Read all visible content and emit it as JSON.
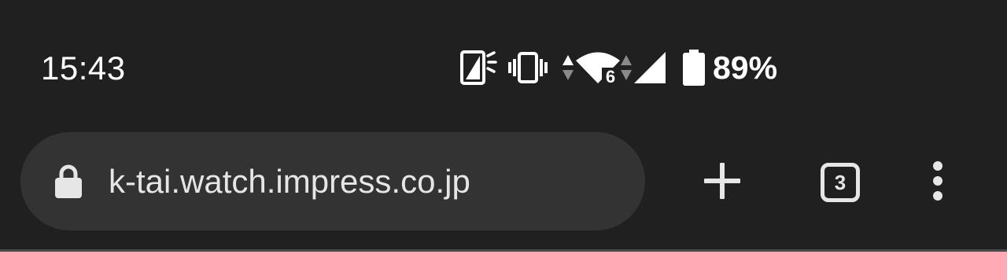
{
  "status_bar": {
    "time": "15:43",
    "wifi_badge": "6",
    "battery_percent": "89%",
    "battery_level": 0.89,
    "icons": [
      "auto-rotate-icon",
      "vibrate-icon",
      "wifi-data-activity-icon",
      "wifi-icon",
      "mobile-data-activity-icon",
      "cell-signal-icon",
      "battery-icon"
    ]
  },
  "toolbar": {
    "url": "k-tai.watch.impress.co.jp",
    "security_icon": "lock-icon",
    "new_tab_icon": "plus-icon",
    "tab_count": "3",
    "menu_icon": "more-vertical-icon"
  },
  "page": {
    "background_color": "#ffaab4"
  },
  "colors": {
    "chrome_background": "#202020",
    "omnibox_background": "#333333",
    "icon_color": "#e6e6e6",
    "status_text": "#ffffff"
  }
}
